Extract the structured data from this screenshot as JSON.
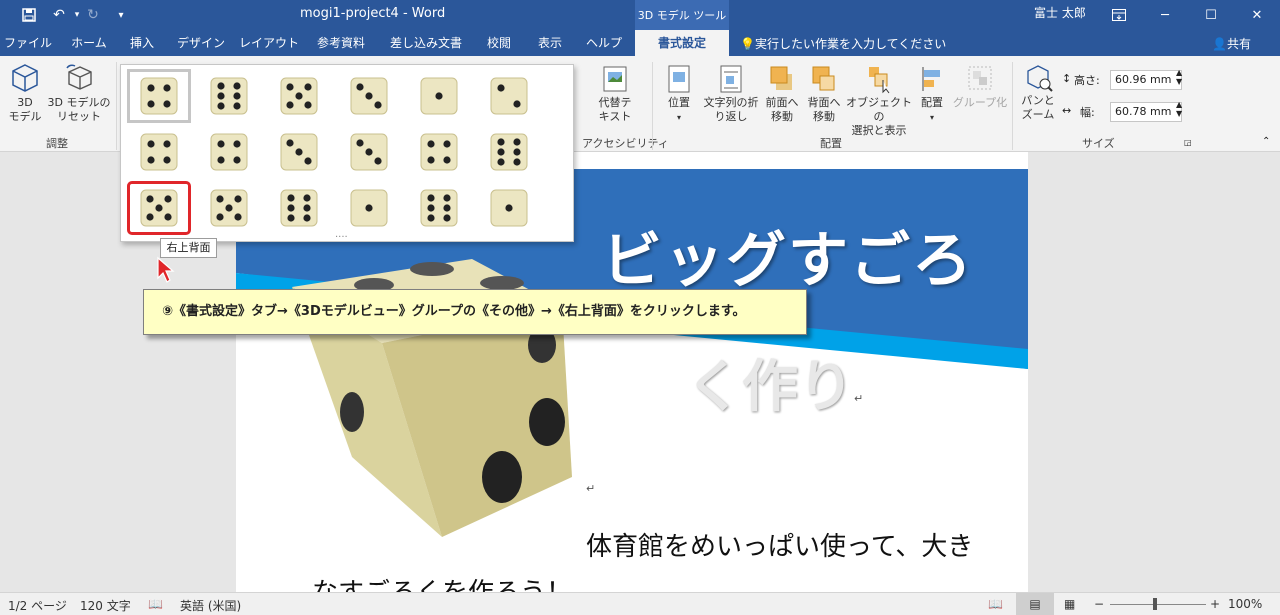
{
  "titlebar": {
    "doc_title": "mogi1-project4  -  Word",
    "context_tool": "3D モデル ツール",
    "user": "富士 太郎",
    "save_icon": "save-icon",
    "undo_icon": "undo-icon",
    "redo_icon": "redo-icon"
  },
  "tabs": [
    {
      "label": "ファイル"
    },
    {
      "label": "ホーム"
    },
    {
      "label": "挿入"
    },
    {
      "label": "デザイン"
    },
    {
      "label": "レイアウト"
    },
    {
      "label": "参考資料"
    },
    {
      "label": "差し込み文書"
    },
    {
      "label": "校閲"
    },
    {
      "label": "表示"
    },
    {
      "label": "ヘルプ"
    },
    {
      "label": "書式設定",
      "active": true
    }
  ],
  "tell_me": "実行したい作業を入力してください",
  "share": "共有",
  "ribbon": {
    "btn_3dmodel": "3D\nモデル",
    "btn_reset": "3D モデルの\nリセット",
    "group_adjust": "調整",
    "btn_alt_text": "代替テ\nキスト",
    "group_access": "アクセシビリティ",
    "btn_position": "位置",
    "btn_wrap": "文字列の折\nり返し",
    "btn_forward": "前面へ\n移動",
    "btn_backward": "背面へ\n移動",
    "btn_select": "オブジェクトの\n選択と表示",
    "btn_align": "配置",
    "btn_group": "グループ化",
    "group_arrange": "配置",
    "btn_pan": "パンと\nズーム",
    "height_label": "高さ:",
    "height_value": "60.96 mm",
    "width_label": "幅:",
    "width_value": "60.78 mm",
    "group_size": "サイズ"
  },
  "gallery": {
    "tooltip": "右上背面",
    "more": "....",
    "views": [
      {
        "name": "front",
        "pips": 4
      },
      {
        "name": "top",
        "pips": 6
      },
      {
        "name": "bottom",
        "pips": 5
      },
      {
        "name": "right",
        "pips": 3
      },
      {
        "name": "left",
        "pips": 1
      },
      {
        "name": "back",
        "pips": 2
      },
      {
        "name": "front-left",
        "pips": 4
      },
      {
        "name": "front-right",
        "pips": 4
      },
      {
        "name": "left-top",
        "pips": 3
      },
      {
        "name": "right-top",
        "pips": 3
      },
      {
        "name": "left-bottom",
        "pips": 4
      },
      {
        "name": "right-bottom",
        "pips": 6
      },
      {
        "name": "upper-right-back",
        "pips": 5
      },
      {
        "name": "upper-left-back",
        "pips": 5
      },
      {
        "name": "lower-right-back",
        "pips": 6
      },
      {
        "name": "lower-left-back",
        "pips": 1
      },
      {
        "name": "top-front",
        "pips": 6
      },
      {
        "name": "bottom-front",
        "pips": 1
      }
    ]
  },
  "document": {
    "title_line1": "ビッグすごろ",
    "title_line2": "く作り",
    "body_line1": "体育館をめいっぱい使って、大き",
    "body_line2": "なすごろくを作ろう！",
    "return_mark": "↵"
  },
  "callout": "⑨《書式設定》タブ→《3Dモデルビュー》グループの《その他》→《右上背面》をクリックします。",
  "status": {
    "page": "1/2 ページ",
    "words": "120 文字",
    "lang": "英語 (米国)",
    "zoom": "100%"
  },
  "colors": {
    "word_blue": "#2b579a",
    "banner_blue": "#2f6fba",
    "banner_cyan": "#00a2e8",
    "highlight_red": "#e0262a",
    "callout_bg": "#ffffc4"
  }
}
